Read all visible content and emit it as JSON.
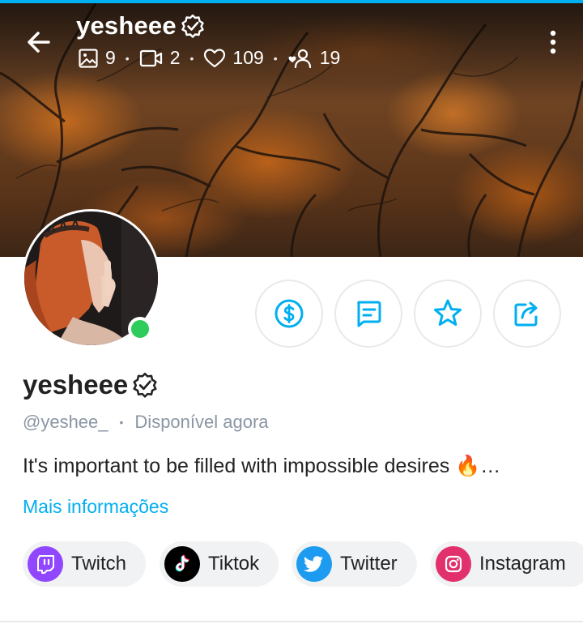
{
  "header": {
    "username": "yesheee",
    "stats": {
      "photos": "9",
      "videos": "2",
      "likes": "109",
      "fans": "19"
    }
  },
  "profile": {
    "display_name": "yesheee",
    "handle": "@yeshee_",
    "separator": "•",
    "status": "Disponível agora",
    "bio": "It's important to be filled with impossible desires 🔥…",
    "more_info": "Mais informações"
  },
  "actions": [
    {
      "icon": "dollar-icon"
    },
    {
      "icon": "message-icon"
    },
    {
      "icon": "star-icon"
    },
    {
      "icon": "share-icon"
    }
  ],
  "socials": [
    {
      "label": "Twitch",
      "icon": "twitch-icon",
      "color": "#9146ff"
    },
    {
      "label": "Tiktok",
      "icon": "tiktok-icon",
      "color": "#000000"
    },
    {
      "label": "Twitter",
      "icon": "twitter-icon",
      "color": "#1d9bf0"
    },
    {
      "label": "Instagram",
      "icon": "instagram-icon",
      "color": "#e1306c"
    }
  ],
  "colors": {
    "accent": "#00aff0",
    "online": "#2ecc5a",
    "muted": "#8a96a3"
  }
}
